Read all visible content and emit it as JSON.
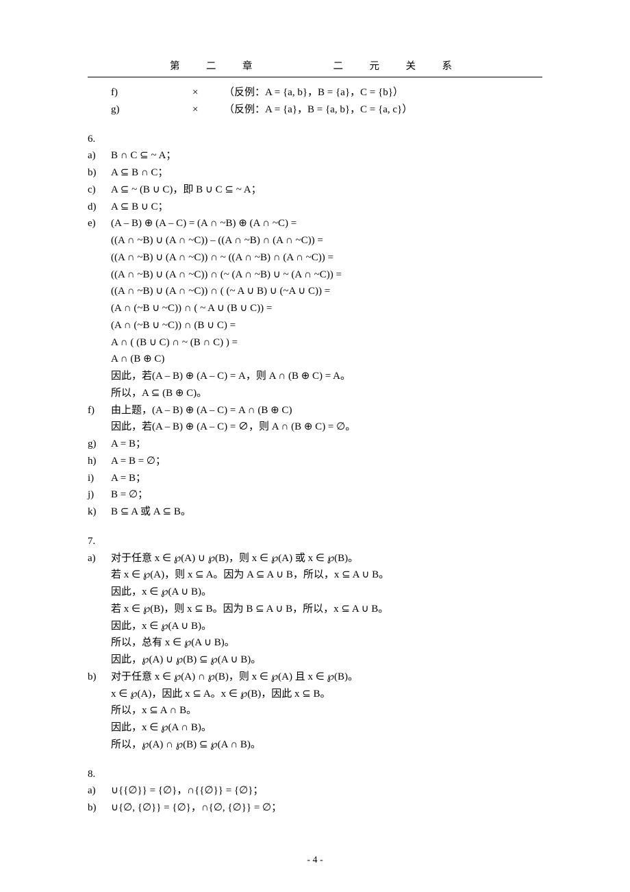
{
  "header": "第　二　章　　　　二　元　关　系",
  "top_items": [
    {
      "label": "f)",
      "mark": "×",
      "text": "（反例：A = {a, b}，B = {a}，C = {b}）"
    },
    {
      "label": "g)",
      "mark": "×",
      "text": "（反例：A = {a}，B = {a, b}，C = {a, c}）"
    }
  ],
  "sec6": {
    "num": "6.",
    "items": {
      "a": {
        "label": "a)",
        "text": "B ∩ C ⊆ ~ A；"
      },
      "b": {
        "label": "b)",
        "text": "A ⊆ B ∩ C；"
      },
      "c": {
        "label": "c)",
        "text": "A ⊆ ~ (B ∪ C)，即 B ∪ C ⊆ ~ A；"
      },
      "d": {
        "label": "d)",
        "text": "A ⊆ B ∪ C；"
      },
      "e": {
        "label": "e)",
        "lines": [
          "(A – B) ⊕ (A – C) = (A ∩ ~B) ⊕ (A ∩ ~C) =",
          "((A ∩ ~B) ∪ (A ∩ ~C)) – ((A ∩ ~B) ∩ (A ∩ ~C)) =",
          "((A ∩ ~B) ∪ (A ∩ ~C)) ∩ ~ ((A ∩ ~B) ∩ (A ∩ ~C)) =",
          "((A ∩ ~B) ∪ (A ∩ ~C)) ∩ (~ (A ∩ ~B) ∪ ~ (A ∩ ~C)) =",
          "((A ∩ ~B) ∪ (A ∩ ~C)) ∩ ( (~ A ∪ B) ∪ (~A ∪ C)) =",
          "(A ∩ (~B ∪ ~C)) ∩ ( ~ A ∪ (B ∪ C)) =",
          "(A ∩ (~B ∪ ~C)) ∩ (B ∪ C) =",
          "A ∩ ( (B ∪ C) ∩ ~ (B ∩ C) ) =",
          "A ∩ (B ⊕ C)",
          "因此，若(A – B) ⊕ (A – C) = A，则 A ∩ (B ⊕ C) = A。",
          "所以，A ⊆ (B ⊕ C)。"
        ]
      },
      "f": {
        "label": "f)",
        "lines": [
          "由上题，(A – B) ⊕ (A – C) = A ∩ (B ⊕ C)",
          "因此，若(A – B) ⊕ (A – C) = ∅，则 A ∩ (B ⊕ C) = ∅。"
        ]
      },
      "g": {
        "label": "g)",
        "text": "A = B；"
      },
      "h": {
        "label": "h)",
        "text": "A = B = ∅；"
      },
      "i": {
        "label": "i)",
        "text": "A = B；"
      },
      "j": {
        "label": "j)",
        "text": "B = ∅；"
      },
      "k": {
        "label": "k)",
        "text": "B ⊆ A  或  A ⊆ B。"
      }
    }
  },
  "sec7": {
    "num": "7.",
    "a": {
      "label": "a)",
      "lines": [
        "对于任意 x ∈ ℘(A) ∪ ℘(B)，则 x ∈ ℘(A)  或 x ∈ ℘(B)。",
        "若 x ∈ ℘(A)，则 x ⊆ A。因为 A ⊆ A ∪ B，所以，x ⊆ A ∪ B。",
        "因此，x ∈ ℘(A ∪ B)。",
        "若 x ∈ ℘(B)，则 x ⊆ B。因为 B ⊆ A ∪ B，所以，x ⊆ A ∪ B。",
        "因此，x ∈ ℘(A ∪ B)。",
        "所以，总有 x ∈ ℘(A ∪ B)。",
        "因此，℘(A) ∪ ℘(B) ⊆ ℘(A ∪ B)。"
      ]
    },
    "b": {
      "label": "b)",
      "lines": [
        "对于任意 x ∈ ℘(A) ∩ ℘(B)，则 x ∈ ℘(A)  且 x ∈ ℘(B)。",
        "x ∈ ℘(A)，因此 x ⊆ A。x ∈ ℘(B)，因此 x ⊆ B。",
        "所以，x ⊆ A ∩ B。",
        "因此，x ∈ ℘(A ∩ B)。",
        "所以，℘(A) ∩ ℘(B) ⊆ ℘(A ∩ B)。"
      ]
    }
  },
  "sec8": {
    "num": "8.",
    "a": {
      "label": "a)",
      "text": "∪{{∅}} = {∅}，∩{{∅}} = {∅}；"
    },
    "b": {
      "label": "b)",
      "text": "∪{∅, {∅}} = {∅}，∩{∅, {∅}} = ∅；"
    }
  },
  "footer": "- 4 -"
}
